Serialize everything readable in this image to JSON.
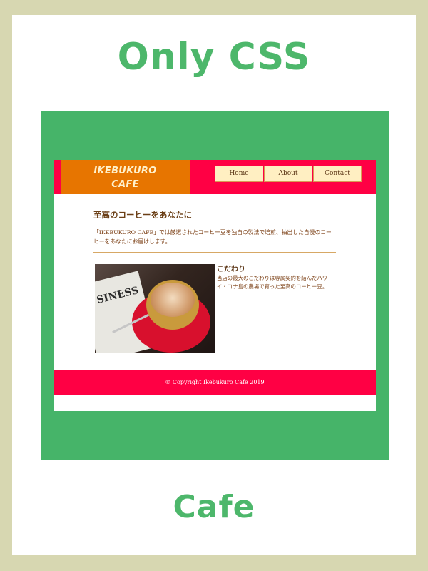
{
  "poster": {
    "title_top": "Only CSS",
    "title_bottom": "Cafe"
  },
  "site": {
    "logo_line1": "IKEBUKURO",
    "logo_line2": "CAFE",
    "nav": [
      "Home",
      "About",
      "Contact"
    ],
    "intro_title": "至高のコーヒーをあなたに",
    "intro_text": "「IKEBUKURO CAFE」では厳選されたコーヒー豆を独自の製法で焙煎、抽出した自慢のコーヒーをあなたにお届けします。",
    "feature_title": "こだわり",
    "feature_text": "当店の最大のこだわりは専属契約を結んだハワイ・コナ島の農場で育った至高のコーヒー豆。",
    "photo_newspaper_text": "SINESS",
    "footer": "© Copyright Ikebukuro Cafe 2019"
  },
  "colors": {
    "frame_border": "#d7d7b1",
    "accent_green": "#46b469",
    "header_red": "#ff0044",
    "logo_orange": "#e77500",
    "nav_cream": "#ffefc2",
    "text_brown": "#7a3d12"
  }
}
